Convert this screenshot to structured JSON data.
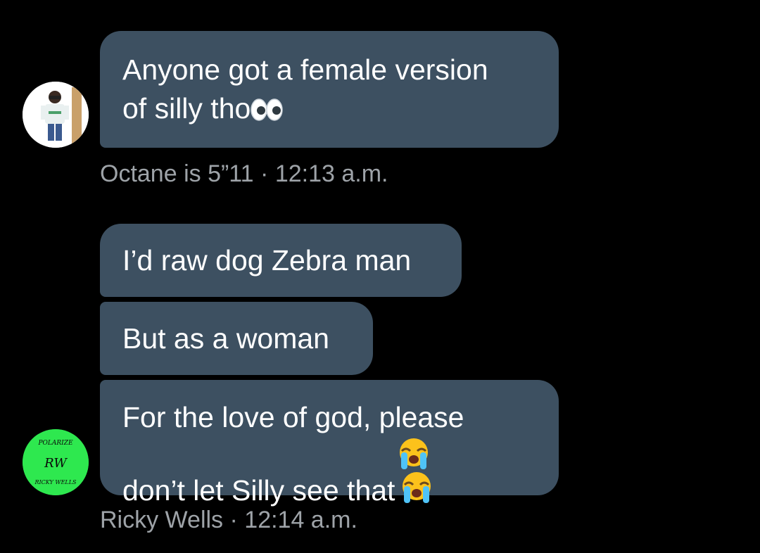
{
  "groups": [
    {
      "sender": "Octane is 5”11",
      "separator": "·",
      "time": "12:13 a.m.",
      "messages": [
        {
          "lines": [
            "Anyone got a female version",
            "of silly tho"
          ],
          "trailing_emoji": [
            "eyes-emoji"
          ]
        }
      ]
    },
    {
      "sender": "Ricky Wells",
      "separator": "·",
      "time": "12:14 a.m.",
      "avatar_text": {
        "top": "POLARIZE",
        "middle": "RW",
        "bottom": "RICKY WELLS"
      },
      "messages": [
        {
          "lines": [
            "I’d raw dog Zebra man"
          ]
        },
        {
          "lines": [
            "But as a woman"
          ]
        },
        {
          "lines": [
            "For the love of god, please",
            "don’t let Silly see that"
          ],
          "trailing_emoji": [
            "loudly-crying-face-emoji",
            "loudly-crying-face-emoji"
          ]
        }
      ]
    }
  ],
  "colors": {
    "background": "#000000",
    "bubble": "#3d5061",
    "meta_text": "#9ea3a8",
    "avatar_green": "#2ee84f"
  }
}
